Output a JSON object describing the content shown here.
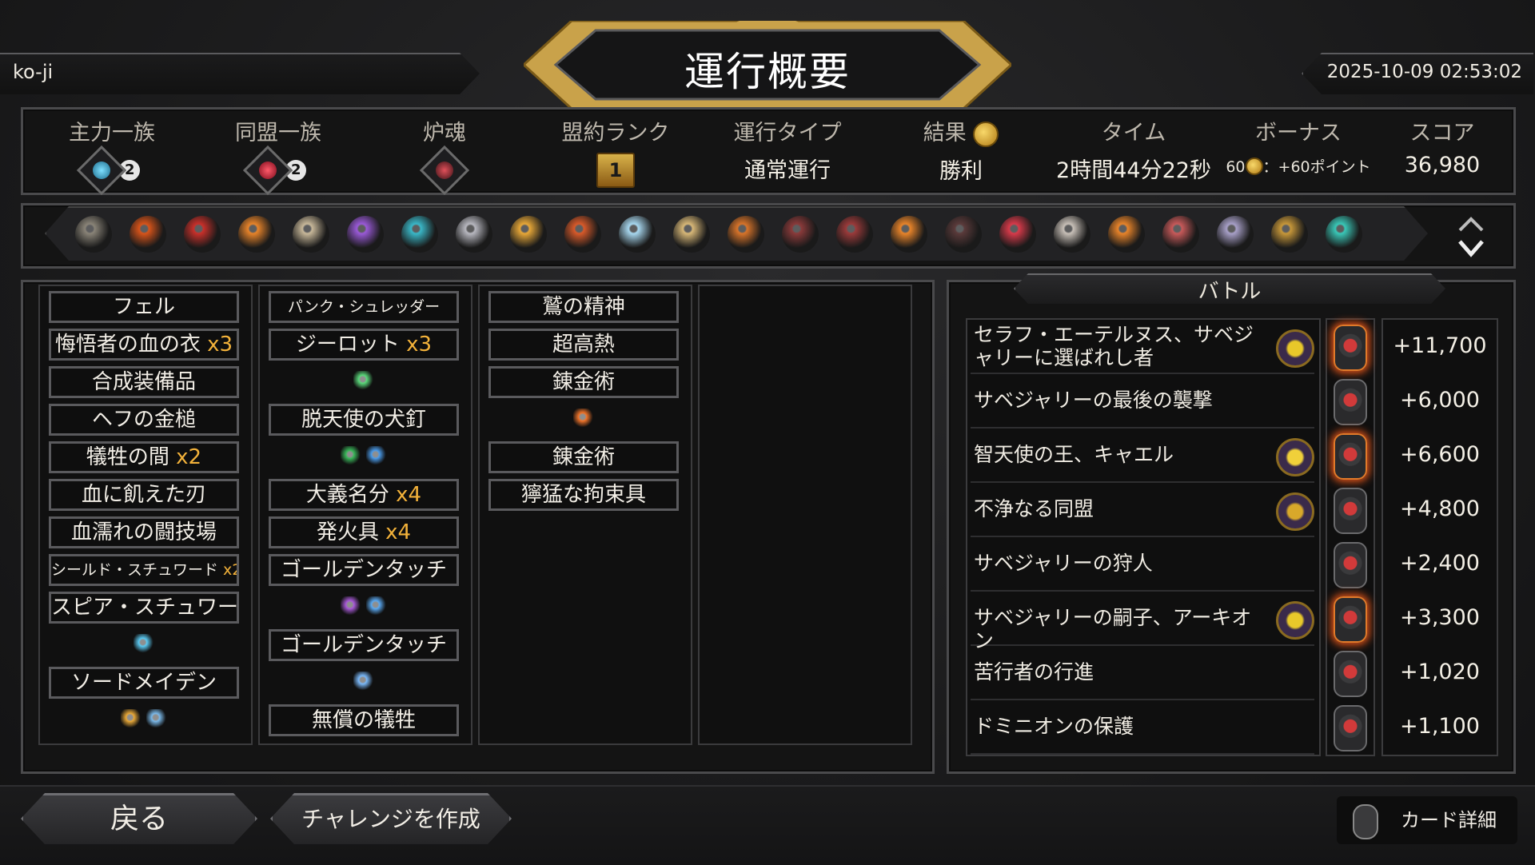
{
  "header": {
    "player_name": "ko-ji",
    "title": "運行概要",
    "datetime": "2025-10-09 02:53:02"
  },
  "stats": {
    "main_clan": {
      "label": "主力一族",
      "value": "2"
    },
    "ally_clan": {
      "label": "同盟一族",
      "value": "2"
    },
    "pyre": {
      "label": "炉魂"
    },
    "covenant": {
      "label": "盟約ランク",
      "value": "1"
    },
    "run_type": {
      "label": "運行タイプ",
      "value": "通常運行"
    },
    "result": {
      "label": "結果",
      "value": "勝利"
    },
    "time": {
      "label": "タイム",
      "value": "2時間44分22秒"
    },
    "bonus": {
      "label": "ボーナス",
      "amount": "60",
      "value": "：+60ポイント"
    },
    "score": {
      "label": "スコア",
      "value": "36,980"
    }
  },
  "relics": [
    "stone-relic-icon",
    "ember-orb-icon",
    "crimson-bird-icon",
    "flame-card-icon",
    "skull-bird-icon",
    "violet-crystal-icon",
    "teal-wings-icon",
    "ghost-icon",
    "sun-orb-icon",
    "demon-mask-icon",
    "ice-shard-icon",
    "lantern-icon",
    "serpent-ring-icon",
    "treasure-chest-icon",
    "potion-icon",
    "flame-card-icon",
    "dark-spider-icon",
    "blood-dagger-icon",
    "feather-icon",
    "flame-claw-icon",
    "fang-maw-icon",
    "scroll-icon",
    "amber-ring-icon",
    "teal-emblem-icon"
  ],
  "deck": {
    "col1": [
      {
        "type": "card",
        "label": "フェル"
      },
      {
        "type": "card",
        "label": "悔悟者の血の衣",
        "mult": "x3"
      },
      {
        "type": "card",
        "label": "合成装備品"
      },
      {
        "type": "card",
        "label": "ヘフの金槌"
      },
      {
        "type": "card",
        "label": "犠牲の間",
        "mult": "x2"
      },
      {
        "type": "card",
        "label": "血に飢えた刃"
      },
      {
        "type": "card",
        "label": "血濡れの闘技場"
      },
      {
        "type": "card",
        "label": "シールド・スチュワード",
        "mult": "x2",
        "small": true
      },
      {
        "type": "card",
        "label": "スピア・スチュワード"
      },
      {
        "type": "icons",
        "icons": [
          "ice-shard-icon"
        ]
      },
      {
        "type": "card",
        "label": "ソードメイデン"
      },
      {
        "type": "icons",
        "icons": [
          "boot-icon",
          "crossed-swords-icon"
        ]
      }
    ],
    "col2": [
      {
        "type": "card",
        "label": "パンク・シュレッダー",
        "small": true
      },
      {
        "type": "card",
        "label": "ジーロット",
        "mult": "x3"
      },
      {
        "type": "icons",
        "icons": [
          "green-crystal-icon"
        ]
      },
      {
        "type": "card",
        "label": "脱天使の犬釘"
      },
      {
        "type": "icons",
        "icons": [
          "green-eye-icon",
          "blue-cube-icon"
        ]
      },
      {
        "type": "card",
        "label": "大義名分",
        "mult": "x4"
      },
      {
        "type": "card",
        "label": "発火具",
        "mult": "x4"
      },
      {
        "type": "card",
        "label": "ゴールデンタッチ"
      },
      {
        "type": "icons",
        "icons": [
          "purple-flame-icon",
          "blue-star-icon"
        ]
      },
      {
        "type": "card",
        "label": "ゴールデンタッチ"
      },
      {
        "type": "icons",
        "icons": [
          "blue-spark-icon"
        ]
      },
      {
        "type": "card",
        "label": "無償の犠牲"
      }
    ],
    "col3": [
      {
        "type": "card",
        "label": "鷲の精神"
      },
      {
        "type": "card",
        "label": "超高熱"
      },
      {
        "type": "card",
        "label": "錬金術"
      },
      {
        "type": "icons",
        "icons": [
          "fire-icon"
        ]
      },
      {
        "type": "card",
        "label": "錬金術"
      },
      {
        "type": "card",
        "label": "獰猛な拘束具"
      }
    ]
  },
  "battle": {
    "title": "バトル",
    "rows": [
      {
        "name": "セラフ・エーテルヌス、サベジャリーに選ばれし者",
        "boss": true,
        "boss_icon": "yellow-beast-icon",
        "fire": true,
        "score": "+11,700"
      },
      {
        "name": "サベジャリーの最後の襲撃",
        "boss": false,
        "fire": false,
        "score": "+6,000"
      },
      {
        "name": "智天使の王、キャエル",
        "boss": true,
        "boss_icon": "golden-sun-icon",
        "fire": true,
        "score": "+6,600"
      },
      {
        "name": "不浄なる同盟",
        "boss": true,
        "boss_icon": "honeycomb-icon",
        "fire": false,
        "score": "+4,800"
      },
      {
        "name": "サベジャリーの狩人",
        "boss": false,
        "fire": false,
        "score": "+2,400"
      },
      {
        "name": "サベジャリーの嗣子、アーキオン",
        "boss": true,
        "boss_icon": "yellow-beast-icon",
        "fire": true,
        "score": "+3,300"
      },
      {
        "name": "苦行者の行進",
        "boss": false,
        "fire": false,
        "score": "+1,020"
      },
      {
        "name": "ドミニオンの保護",
        "boss": false,
        "fire": false,
        "score": "+1,100"
      }
    ]
  },
  "footer": {
    "back_label": "戻る",
    "challenge_label": "チャレンジを作成",
    "detail_label": "カード詳細"
  },
  "colors": {
    "accent_gold": "#d9b24a",
    "multiplier": "#f3b23a",
    "panel_border": "#4a4a4c"
  }
}
